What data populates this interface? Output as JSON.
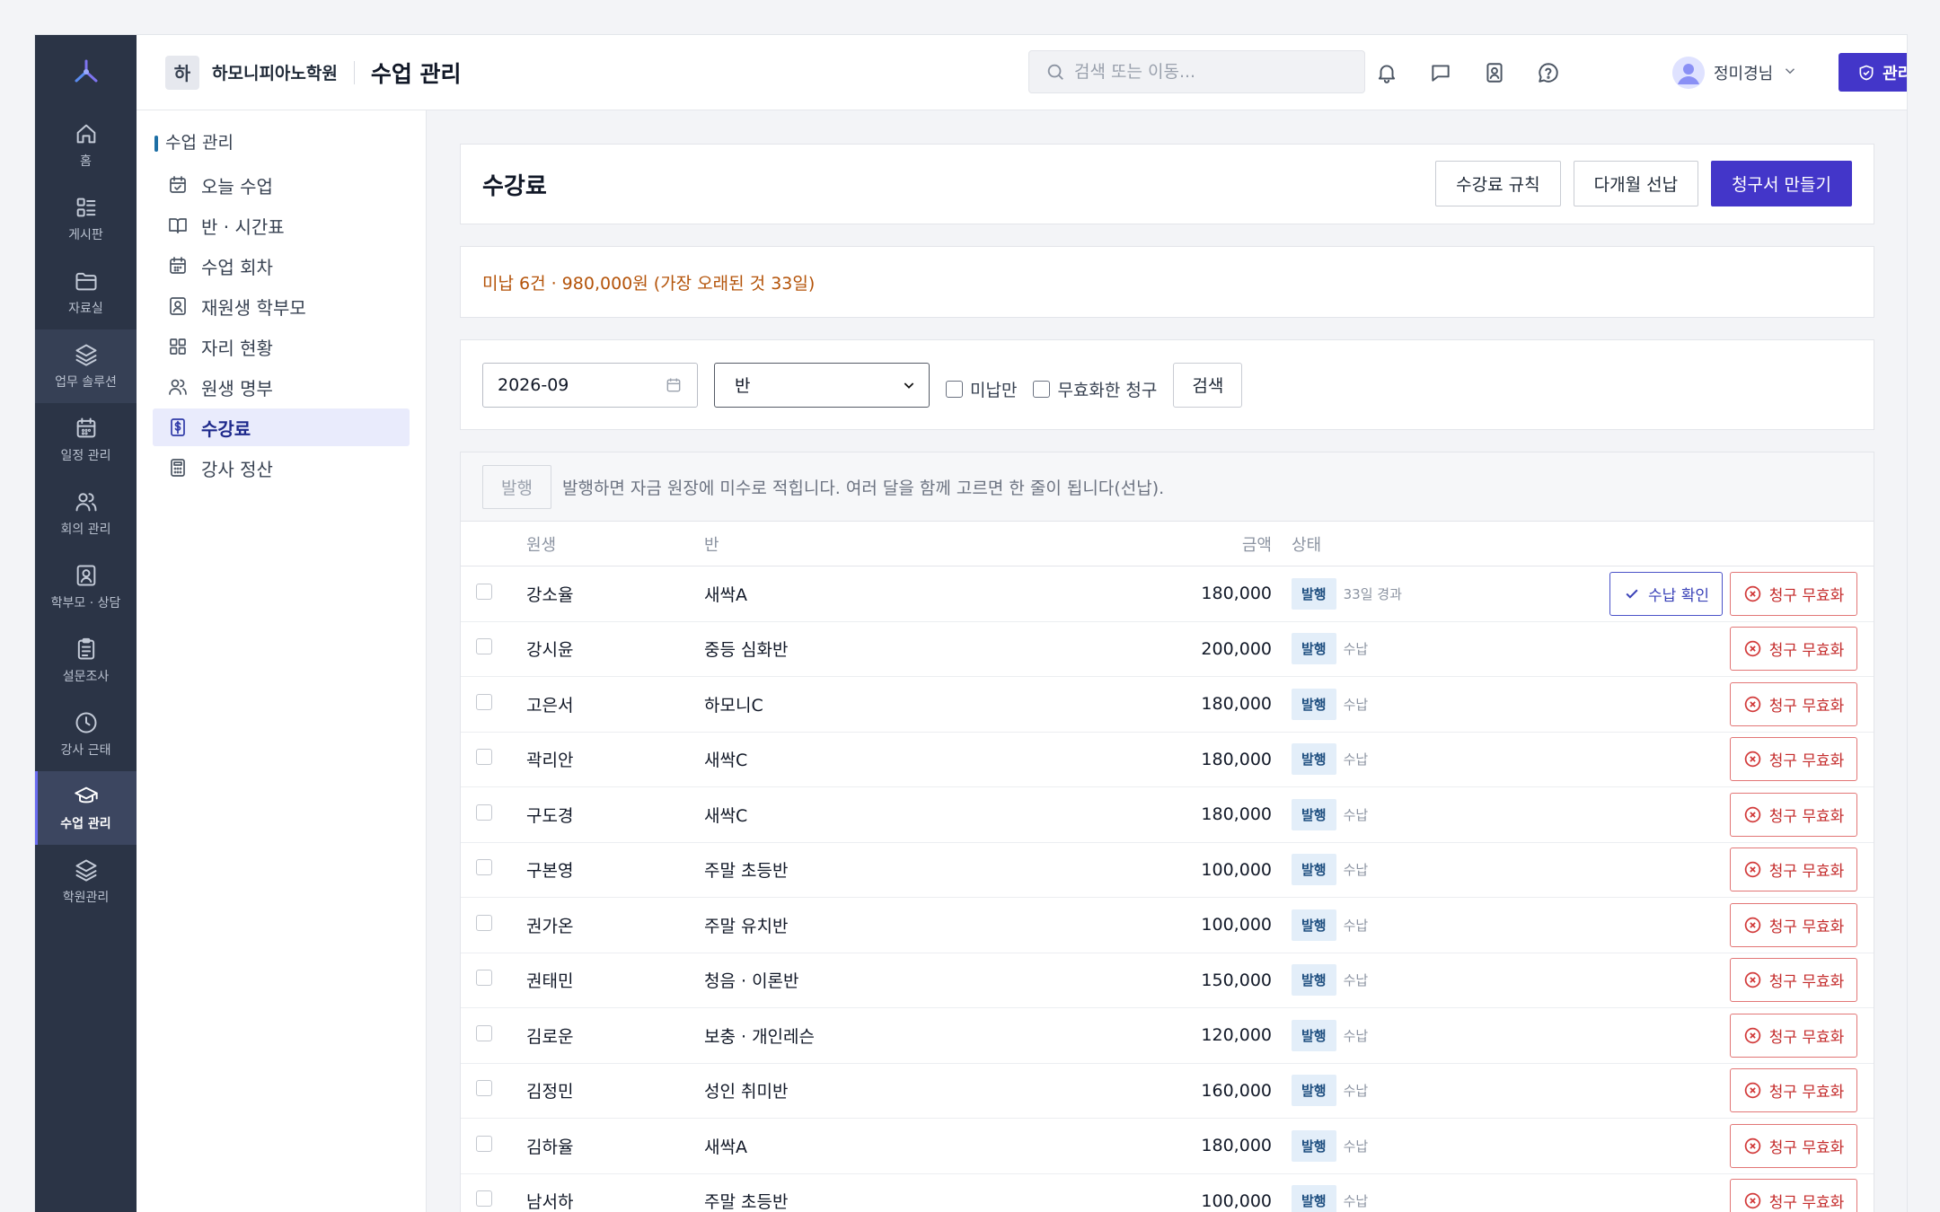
{
  "rail": {
    "items": [
      {
        "label": "홈",
        "icon": "home-icon"
      },
      {
        "label": "게시판",
        "icon": "board-icon"
      },
      {
        "label": "자료실",
        "icon": "folder-icon"
      },
      {
        "label": "업무 솔루션",
        "icon": "layers-icon"
      },
      {
        "label": "일정 관리",
        "icon": "calendar-icon"
      },
      {
        "label": "회의 관리",
        "icon": "users-icon"
      },
      {
        "label": "학부모 · 상담",
        "icon": "contact-icon"
      },
      {
        "label": "설문조사",
        "icon": "clipboard-icon"
      },
      {
        "label": "강사 근태",
        "icon": "clock-icon"
      },
      {
        "label": "수업 관리",
        "icon": "graduation-cap-icon"
      },
      {
        "label": "학원관리",
        "icon": "layers-icon"
      }
    ]
  },
  "header": {
    "org_badge": "하",
    "org_name": "하모니피아노학원",
    "page_name": "수업 관리",
    "search_placeholder": "검색 또는 이동...",
    "user_name": "정미경님",
    "admin_button": "관리자 메뉴"
  },
  "subnav": {
    "title": "수업 관리",
    "items": [
      {
        "label": "오늘 수업",
        "icon": "calendar-check-icon"
      },
      {
        "label": "반 · 시간표",
        "icon": "book-open-icon"
      },
      {
        "label": "수업 회차",
        "icon": "calendar-grid-icon"
      },
      {
        "label": "재원생 학부모",
        "icon": "contact-icon"
      },
      {
        "label": "자리 현황",
        "icon": "grid-icon"
      },
      {
        "label": "원생 명부",
        "icon": "users-icon"
      },
      {
        "label": "수강료",
        "icon": "receipt-dollar-icon"
      },
      {
        "label": "강사 정산",
        "icon": "calculator-icon"
      }
    ]
  },
  "page": {
    "title": "수강료",
    "buttons": {
      "rules": "수강료 규칙",
      "prepay": "다개월 선납",
      "create_invoice": "청구서 만들기"
    },
    "notice": "미납 6건 · 980,000원 (가장 오래된 것 33일)"
  },
  "filters": {
    "month": "2026-09",
    "class_select": "반",
    "unpaid_only": "미납만",
    "voided": "무효화한 청구",
    "search_button": "검색"
  },
  "bulk": {
    "issue_button": "발행",
    "hint": "발행하면 자금 원장에 미수로 적힙니다. 여러 달을 함께 고르면 한 줄이 됩니다(선납)."
  },
  "table": {
    "headers": {
      "name": "원생",
      "class": "반",
      "amount": "금액",
      "status": "상태"
    },
    "confirm_label": "수납 확인",
    "void_label": "청구 무효화",
    "rows": [
      {
        "name": "강소율",
        "class": "새싹A",
        "amount": "180,000",
        "badge": "발행",
        "note": "33일 경과",
        "confirm": true
      },
      {
        "name": "강시윤",
        "class": "중등 심화반",
        "amount": "200,000",
        "badge": "발행",
        "note": "수납",
        "confirm": false
      },
      {
        "name": "고은서",
        "class": "하모니C",
        "amount": "180,000",
        "badge": "발행",
        "note": "수납",
        "confirm": false
      },
      {
        "name": "곽리안",
        "class": "새싹C",
        "amount": "180,000",
        "badge": "발행",
        "note": "수납",
        "confirm": false
      },
      {
        "name": "구도경",
        "class": "새싹C",
        "amount": "180,000",
        "badge": "발행",
        "note": "수납",
        "confirm": false
      },
      {
        "name": "구본영",
        "class": "주말 초등반",
        "amount": "100,000",
        "badge": "발행",
        "note": "수납",
        "confirm": false
      },
      {
        "name": "권가온",
        "class": "주말 유치반",
        "amount": "100,000",
        "badge": "발행",
        "note": "수납",
        "confirm": false
      },
      {
        "name": "권태민",
        "class": "청음 · 이론반",
        "amount": "150,000",
        "badge": "발행",
        "note": "수납",
        "confirm": false
      },
      {
        "name": "김로운",
        "class": "보충 · 개인레슨",
        "amount": "120,000",
        "badge": "발행",
        "note": "수납",
        "confirm": false
      },
      {
        "name": "김정민",
        "class": "성인 취미반",
        "amount": "160,000",
        "badge": "발행",
        "note": "수납",
        "confirm": false
      },
      {
        "name": "김하율",
        "class": "새싹A",
        "amount": "180,000",
        "badge": "발행",
        "note": "수납",
        "confirm": false
      },
      {
        "name": "남서하",
        "class": "주말 초등반",
        "amount": "100,000",
        "badge": "발행",
        "note": "수납",
        "confirm": false
      }
    ]
  },
  "colors": {
    "accent": "#4336c9",
    "rail_bg": "#2b3446",
    "notice": "#b45309",
    "danger": "#c42b2b",
    "badge_bg": "#e3eef9"
  }
}
